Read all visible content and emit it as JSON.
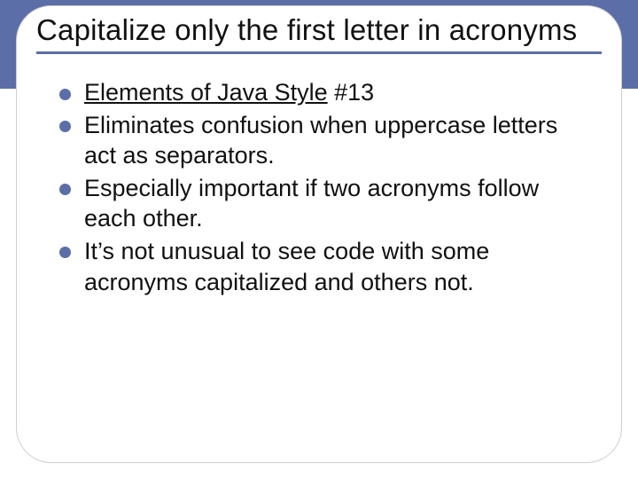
{
  "title": "Capitalize only the first letter in acronyms",
  "bullets": [
    {
      "pre": "",
      "link": "Elements of Java Style",
      "post": " #13"
    },
    {
      "pre": "Eliminates confusion when uppercase letters act as separators.",
      "link": "",
      "post": ""
    },
    {
      "pre": "Especially important if two acronyms follow each other.",
      "link": "",
      "post": ""
    },
    {
      "pre": "It’s not unusual to see code with some acronyms capitalized and others not.",
      "link": "",
      "post": ""
    }
  ]
}
